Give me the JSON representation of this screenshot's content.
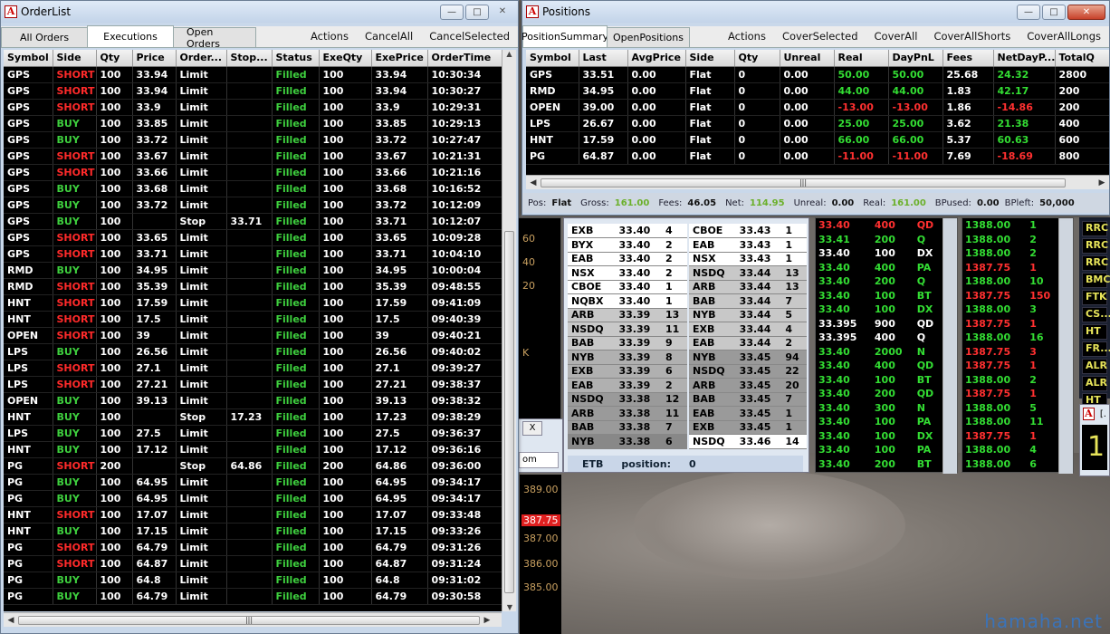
{
  "watermark": "hamaha.net",
  "orderlist": {
    "title": "OrderList",
    "tabs": [
      "All Orders",
      "Executions",
      "Open Orders"
    ],
    "actions": [
      "Actions",
      "CancelAll",
      "CancelSelected"
    ],
    "columns": [
      "Symbol",
      "Side",
      "Qty",
      "Price",
      "Order...",
      "Stop...",
      "Status",
      "ExeQty",
      "ExePrice",
      "OrderTime"
    ],
    "rows": [
      [
        "GPS",
        "SHORT",
        "100",
        "33.94",
        "Limit",
        "",
        "Filled",
        "100",
        "33.94",
        "10:30:34"
      ],
      [
        "GPS",
        "SHORT",
        "100",
        "33.94",
        "Limit",
        "",
        "Filled",
        "100",
        "33.94",
        "10:30:27"
      ],
      [
        "GPS",
        "SHORT",
        "100",
        "33.9",
        "Limit",
        "",
        "Filled",
        "100",
        "33.9",
        "10:29:31"
      ],
      [
        "GPS",
        "BUY",
        "100",
        "33.85",
        "Limit",
        "",
        "Filled",
        "100",
        "33.85",
        "10:29:13"
      ],
      [
        "GPS",
        "BUY",
        "100",
        "33.72",
        "Limit",
        "",
        "Filled",
        "100",
        "33.72",
        "10:27:47"
      ],
      [
        "GPS",
        "SHORT",
        "100",
        "33.67",
        "Limit",
        "",
        "Filled",
        "100",
        "33.67",
        "10:21:31"
      ],
      [
        "GPS",
        "SHORT",
        "100",
        "33.66",
        "Limit",
        "",
        "Filled",
        "100",
        "33.66",
        "10:21:16"
      ],
      [
        "GPS",
        "BUY",
        "100",
        "33.68",
        "Limit",
        "",
        "Filled",
        "100",
        "33.68",
        "10:16:52"
      ],
      [
        "GPS",
        "BUY",
        "100",
        "33.72",
        "Limit",
        "",
        "Filled",
        "100",
        "33.72",
        "10:12:09"
      ],
      [
        "GPS",
        "BUY",
        "100",
        "",
        "Stop",
        "33.71",
        "Filled",
        "100",
        "33.71",
        "10:12:07"
      ],
      [
        "GPS",
        "SHORT",
        "100",
        "33.65",
        "Limit",
        "",
        "Filled",
        "100",
        "33.65",
        "10:09:28"
      ],
      [
        "GPS",
        "SHORT",
        "100",
        "33.71",
        "Limit",
        "",
        "Filled",
        "100",
        "33.71",
        "10:04:10"
      ],
      [
        "RMD",
        "BUY",
        "100",
        "34.95",
        "Limit",
        "",
        "Filled",
        "100",
        "34.95",
        "10:00:04"
      ],
      [
        "RMD",
        "SHORT",
        "100",
        "35.39",
        "Limit",
        "",
        "Filled",
        "100",
        "35.39",
        "09:48:55"
      ],
      [
        "HNT",
        "SHORT",
        "100",
        "17.59",
        "Limit",
        "",
        "Filled",
        "100",
        "17.59",
        "09:41:09"
      ],
      [
        "HNT",
        "SHORT",
        "100",
        "17.5",
        "Limit",
        "",
        "Filled",
        "100",
        "17.5",
        "09:40:39"
      ],
      [
        "OPEN",
        "SHORT",
        "100",
        "39",
        "Limit",
        "",
        "Filled",
        "100",
        "39",
        "09:40:21"
      ],
      [
        "LPS",
        "BUY",
        "100",
        "26.56",
        "Limit",
        "",
        "Filled",
        "100",
        "26.56",
        "09:40:02"
      ],
      [
        "LPS",
        "SHORT",
        "100",
        "27.1",
        "Limit",
        "",
        "Filled",
        "100",
        "27.1",
        "09:39:27"
      ],
      [
        "LPS",
        "SHORT",
        "100",
        "27.21",
        "Limit",
        "",
        "Filled",
        "100",
        "27.21",
        "09:38:37"
      ],
      [
        "OPEN",
        "BUY",
        "100",
        "39.13",
        "Limit",
        "",
        "Filled",
        "100",
        "39.13",
        "09:38:32"
      ],
      [
        "HNT",
        "BUY",
        "100",
        "",
        "Stop",
        "17.23",
        "Filled",
        "100",
        "17.23",
        "09:38:29"
      ],
      [
        "LPS",
        "BUY",
        "100",
        "27.5",
        "Limit",
        "",
        "Filled",
        "100",
        "27.5",
        "09:36:37"
      ],
      [
        "HNT",
        "BUY",
        "100",
        "17.12",
        "Limit",
        "",
        "Filled",
        "100",
        "17.12",
        "09:36:16"
      ],
      [
        "PG",
        "SHORT",
        "200",
        "",
        "Stop",
        "64.86",
        "Filled",
        "200",
        "64.86",
        "09:36:00"
      ],
      [
        "PG",
        "BUY",
        "100",
        "64.95",
        "Limit",
        "",
        "Filled",
        "100",
        "64.95",
        "09:34:17"
      ],
      [
        "PG",
        "BUY",
        "100",
        "64.95",
        "Limit",
        "",
        "Filled",
        "100",
        "64.95",
        "09:34:17"
      ],
      [
        "HNT",
        "SHORT",
        "100",
        "17.07",
        "Limit",
        "",
        "Filled",
        "100",
        "17.07",
        "09:33:48"
      ],
      [
        "HNT",
        "BUY",
        "100",
        "17.15",
        "Limit",
        "",
        "Filled",
        "100",
        "17.15",
        "09:33:26"
      ],
      [
        "PG",
        "SHORT",
        "100",
        "64.79",
        "Limit",
        "",
        "Filled",
        "100",
        "64.79",
        "09:31:26"
      ],
      [
        "PG",
        "SHORT",
        "100",
        "64.87",
        "Limit",
        "",
        "Filled",
        "100",
        "64.87",
        "09:31:24"
      ],
      [
        "PG",
        "BUY",
        "100",
        "64.8",
        "Limit",
        "",
        "Filled",
        "100",
        "64.8",
        "09:31:02"
      ],
      [
        "PG",
        "BUY",
        "100",
        "64.79",
        "Limit",
        "",
        "Filled",
        "100",
        "64.79",
        "09:30:58"
      ]
    ]
  },
  "positions": {
    "title": "Positions",
    "tabs": [
      "PositionSummary",
      "OpenPositions"
    ],
    "actions": [
      "Actions",
      "CoverSelected",
      "CoverAll",
      "CoverAllShorts",
      "CoverAllLongs"
    ],
    "columns": [
      "Symbol",
      "Last",
      "AvgPrice",
      "Side",
      "Qty",
      "Unreal",
      "Real",
      "DayPnL",
      "Fees",
      "NetDayP...",
      "TotalQ"
    ],
    "rows": [
      [
        "GPS",
        "33.51",
        "0.00",
        "Flat",
        "0",
        "0.00",
        "50.00",
        "50.00",
        "25.68",
        "24.32",
        "2800"
      ],
      [
        "RMD",
        "34.95",
        "0.00",
        "Flat",
        "0",
        "0.00",
        "44.00",
        "44.00",
        "1.83",
        "42.17",
        "200"
      ],
      [
        "OPEN",
        "39.00",
        "0.00",
        "Flat",
        "0",
        "0.00",
        "-13.00",
        "-13.00",
        "1.86",
        "-14.86",
        "200"
      ],
      [
        "LPS",
        "26.67",
        "0.00",
        "Flat",
        "0",
        "0.00",
        "25.00",
        "25.00",
        "3.62",
        "21.38",
        "400"
      ],
      [
        "HNT",
        "17.59",
        "0.00",
        "Flat",
        "0",
        "0.00",
        "66.00",
        "66.00",
        "5.37",
        "60.63",
        "600"
      ],
      [
        "PG",
        "64.87",
        "0.00",
        "Flat",
        "0",
        "0.00",
        "-11.00",
        "-11.00",
        "7.69",
        "-18.69",
        "800"
      ]
    ],
    "status": {
      "pos_label": "Pos:",
      "pos": "Flat",
      "gross_label": "Gross:",
      "gross": "161.00",
      "fees_label": "Fees:",
      "fees": "46.05",
      "net_label": "Net:",
      "net": "114.95",
      "unreal_label": "Unreal:",
      "unreal": "0.00",
      "real_label": "Real:",
      "real": "161.00",
      "bpused_label": "BPused:",
      "bpused": "0.00",
      "bpleft_label": "BPleft:",
      "bpleft": "50,000"
    }
  },
  "level2": {
    "bid": [
      [
        "EXB",
        "33.40",
        "4"
      ],
      [
        "BYX",
        "33.40",
        "2"
      ],
      [
        "EAB",
        "33.40",
        "2"
      ],
      [
        "NSX",
        "33.40",
        "2"
      ],
      [
        "CBOE",
        "33.40",
        "1"
      ],
      [
        "NQBX",
        "33.40",
        "1"
      ],
      [
        "ARB",
        "33.39",
        "13"
      ],
      [
        "NSDQ",
        "33.39",
        "11"
      ],
      [
        "BAB",
        "33.39",
        "9"
      ],
      [
        "NYB",
        "33.39",
        "8"
      ],
      [
        "EXB",
        "33.39",
        "6"
      ],
      [
        "EAB",
        "33.39",
        "2"
      ],
      [
        "NSDQ",
        "33.38",
        "12"
      ],
      [
        "ARB",
        "33.38",
        "11"
      ],
      [
        "BAB",
        "33.38",
        "7"
      ],
      [
        "NYB",
        "33.38",
        "6"
      ]
    ],
    "ask": [
      [
        "CBOE",
        "33.43",
        "1"
      ],
      [
        "EAB",
        "33.43",
        "1"
      ],
      [
        "NSX",
        "33.43",
        "1"
      ],
      [
        "NSDQ",
        "33.44",
        "13"
      ],
      [
        "ARB",
        "33.44",
        "13"
      ],
      [
        "BAB",
        "33.44",
        "7"
      ],
      [
        "NYB",
        "33.44",
        "5"
      ],
      [
        "EXB",
        "33.44",
        "4"
      ],
      [
        "EAB",
        "33.44",
        "2"
      ],
      [
        "NYB",
        "33.45",
        "94"
      ],
      [
        "NSDQ",
        "33.45",
        "22"
      ],
      [
        "ARB",
        "33.45",
        "20"
      ],
      [
        "BAB",
        "33.45",
        "7"
      ],
      [
        "EAB",
        "33.45",
        "1"
      ],
      [
        "EXB",
        "33.45",
        "1"
      ],
      [
        "NSDQ",
        "33.46",
        "14"
      ]
    ],
    "footer_symbol": "ETB",
    "footer_label": "position:",
    "footer_value": "0"
  },
  "tape1": [
    [
      "33.40",
      "400",
      "QD",
      "r"
    ],
    [
      "33.41",
      "200",
      "Q",
      "g"
    ],
    [
      "33.40",
      "100",
      "DX",
      "w"
    ],
    [
      "33.40",
      "400",
      "PA",
      "g"
    ],
    [
      "33.40",
      "200",
      "Q",
      "g"
    ],
    [
      "33.40",
      "100",
      "BT",
      "g"
    ],
    [
      "33.40",
      "100",
      "DX",
      "g"
    ],
    [
      "33.395",
      "900",
      "QD",
      "w"
    ],
    [
      "33.395",
      "400",
      "Q",
      "w"
    ],
    [
      "33.40",
      "2000",
      "N",
      "g"
    ],
    [
      "33.40",
      "400",
      "QD",
      "g"
    ],
    [
      "33.40",
      "100",
      "BT",
      "g"
    ],
    [
      "33.40",
      "200",
      "QD",
      "g"
    ],
    [
      "33.40",
      "300",
      "N",
      "g"
    ],
    [
      "33.40",
      "100",
      "PA",
      "g"
    ],
    [
      "33.40",
      "100",
      "DX",
      "g"
    ],
    [
      "33.40",
      "100",
      "PA",
      "g"
    ],
    [
      "33.40",
      "200",
      "BT",
      "g"
    ]
  ],
  "tape2": [
    [
      "1388.00",
      "1",
      "g"
    ],
    [
      "1388.00",
      "2",
      "g"
    ],
    [
      "1388.00",
      "2",
      "g"
    ],
    [
      "1387.75",
      "1",
      "r"
    ],
    [
      "1388.00",
      "10",
      "g"
    ],
    [
      "1387.75",
      "150",
      "r"
    ],
    [
      "1388.00",
      "3",
      "g"
    ],
    [
      "1387.75",
      "1",
      "r"
    ],
    [
      "1388.00",
      "16",
      "g"
    ],
    [
      "1387.75",
      "3",
      "r"
    ],
    [
      "1387.75",
      "1",
      "r"
    ],
    [
      "1388.00",
      "2",
      "g"
    ],
    [
      "1387.75",
      "1",
      "r"
    ],
    [
      "1388.00",
      "5",
      "g"
    ],
    [
      "1388.00",
      "11",
      "g"
    ],
    [
      "1387.75",
      "1",
      "r"
    ],
    [
      "1388.00",
      "4",
      "g"
    ],
    [
      "1388.00",
      "6",
      "g"
    ]
  ],
  "side_tickers": [
    "RRC",
    "RRC",
    "RRC",
    "BMC",
    "FTK",
    "CS...",
    "HT",
    "FR...",
    "ALR",
    "ALR",
    "HT"
  ],
  "left_prices": [
    "60",
    "40",
    "20",
    "K"
  ],
  "chart_prices": [
    "389.00",
    "387.75",
    "387.00",
    "386.00",
    "385.00"
  ],
  "small_window": {
    "close": "X",
    "label": "om",
    "big_digit": "1",
    "tab": "[."
  }
}
